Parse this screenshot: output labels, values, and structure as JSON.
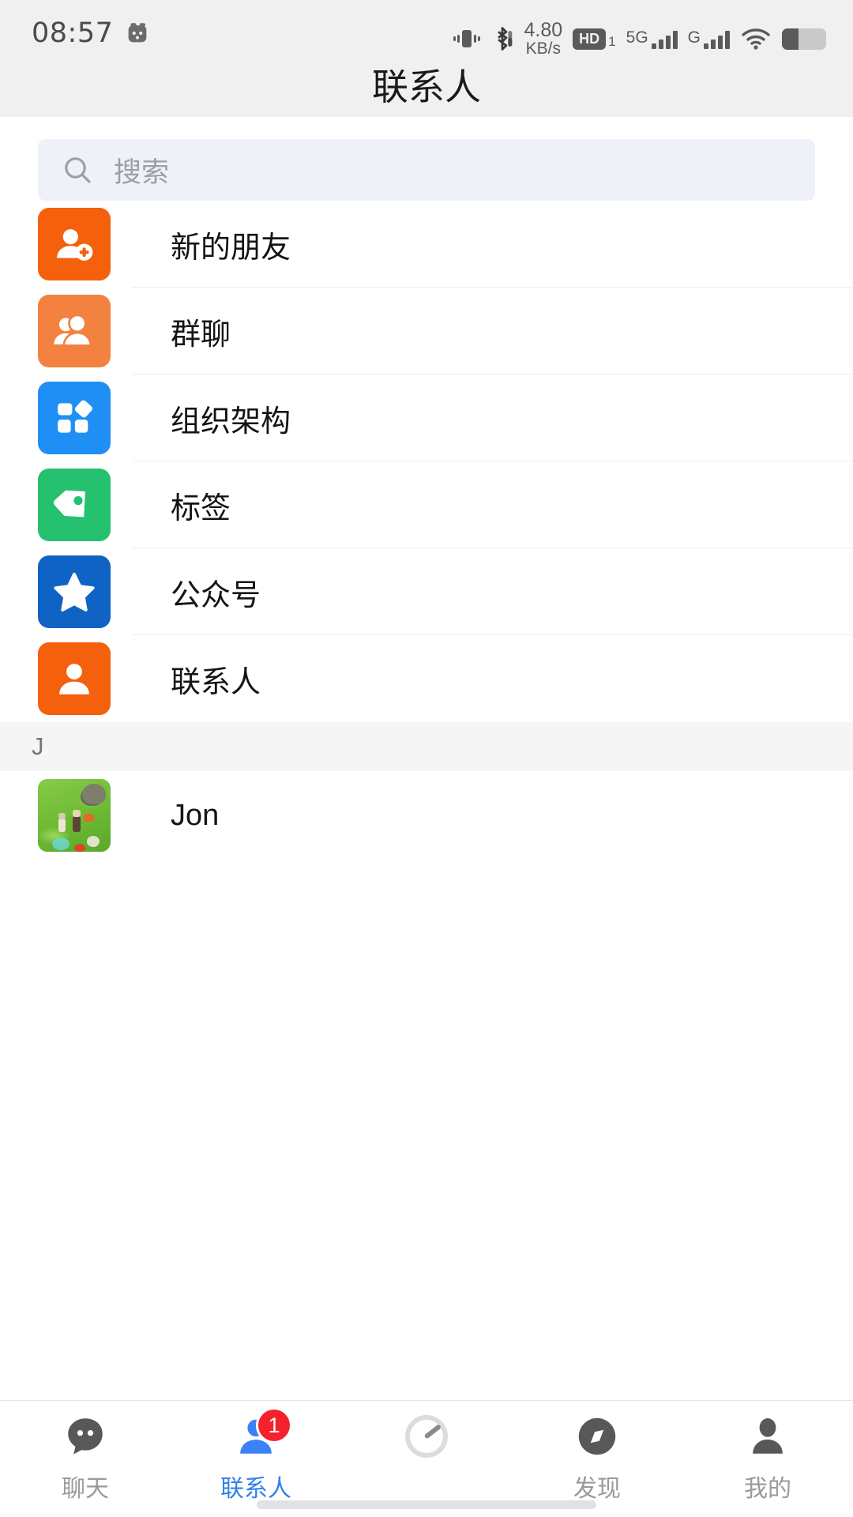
{
  "status_bar": {
    "time": "08:57",
    "alarm_icon": "alarm-clock-icon",
    "vibrate_icon": "vibrate-icon",
    "bluetooth_icon": "bluetooth-icon",
    "net_speed_value": "4.80",
    "net_speed_unit": "KB/s",
    "hd_label": "HD",
    "hd_sub": "1",
    "sim1_net": "5G",
    "sim2_net": "G",
    "wifi_icon": "wifi-icon",
    "battery_icon": "battery-icon"
  },
  "header": {
    "title": "联系人"
  },
  "search": {
    "placeholder": "搜索",
    "icon": "search-icon"
  },
  "entries": [
    {
      "label": "新的朋友",
      "icon": "new-friend-icon",
      "color": "#f4600c"
    },
    {
      "label": "群聊",
      "icon": "group-chat-icon",
      "color": "#f3813f"
    },
    {
      "label": "组织架构",
      "icon": "org-structure-icon",
      "color": "#1f8ff5"
    },
    {
      "label": "标签",
      "icon": "tag-icon",
      "color": "#25c16f"
    },
    {
      "label": "公众号",
      "icon": "official-account-icon",
      "color": "#0f63c4"
    },
    {
      "label": "联系人",
      "icon": "contacts-icon",
      "color": "#f4600c"
    }
  ],
  "sections": [
    {
      "letter": "J",
      "contacts": [
        {
          "name": "Jon",
          "avatar": "game-screenshot-avatar"
        }
      ]
    }
  ],
  "tabbar": [
    {
      "label": "聊天",
      "icon": "chat-bubble-icon",
      "active": false,
      "badge": ""
    },
    {
      "label": "联系人",
      "icon": "contacts-person-icon",
      "active": true,
      "badge": "1"
    },
    {
      "label": "",
      "icon": "gauge-icon",
      "active": false,
      "badge": ""
    },
    {
      "label": "发现",
      "icon": "compass-icon",
      "active": false,
      "badge": ""
    },
    {
      "label": "我的",
      "icon": "profile-person-icon",
      "active": false,
      "badge": ""
    }
  ],
  "colors": {
    "accent": "#2f80ed",
    "badge": "#f5222d",
    "status_band": "#f0f0f0",
    "search_field": "#eef1f7",
    "section_header": "#f5f5f5"
  }
}
